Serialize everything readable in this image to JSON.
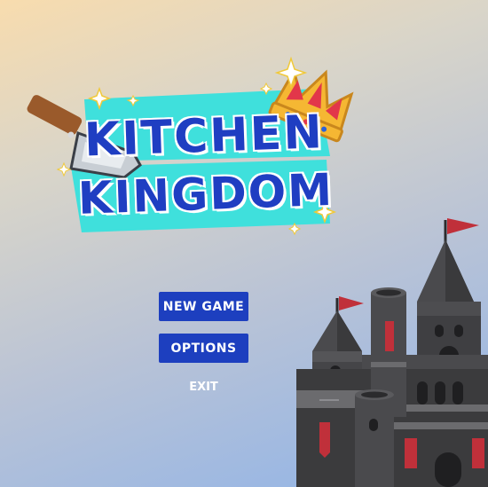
{
  "game": {
    "title_line1": "KITCHEN",
    "title_line2": "KINGDOM"
  },
  "menu": {
    "new_game": "NEW GAME",
    "options": "OPTIONS",
    "exit": "EXIT"
  },
  "colors": {
    "button_bg": "#1d3fbf",
    "title_text": "#1f3ec2",
    "banner": "#3fe0dc",
    "castle_dark": "#3b3b3d",
    "flag": "#c0303a"
  },
  "icons": [
    "cleaver-icon",
    "crown-icon",
    "sparkle-icon",
    "castle-illustration"
  ]
}
